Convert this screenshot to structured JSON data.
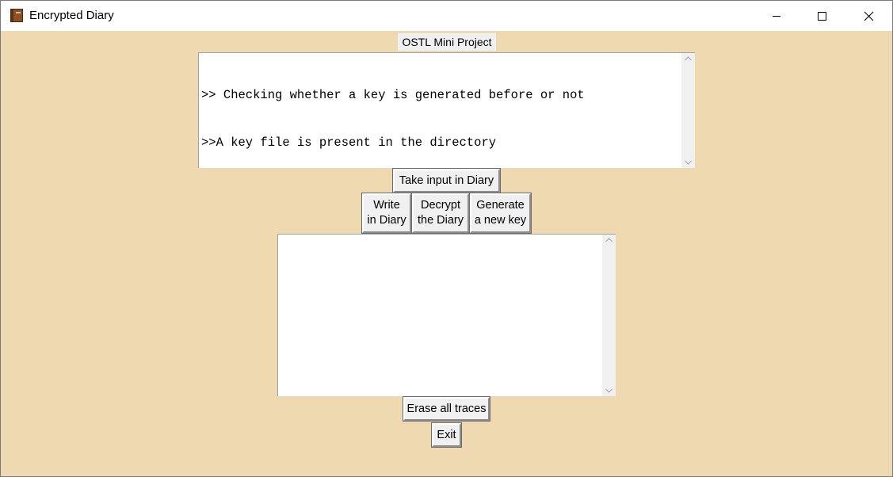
{
  "window": {
    "title": "Encrypted Diary",
    "icon": "diary-book-icon",
    "controls": [
      "minimize-icon",
      "maximize-icon",
      "close-icon"
    ]
  },
  "header": {
    "label": "OSTL Mini Project"
  },
  "log": {
    "lines": [
      ">> Checking whether a key is generated before or not",
      ">>A key file is present in the directory"
    ]
  },
  "buttons": {
    "take_input": "Take input in Diary",
    "write": [
      "Write",
      "in Diary"
    ],
    "decrypt": [
      "Decrypt",
      "the Diary"
    ],
    "generate": [
      "Generate",
      "a new key"
    ],
    "erase": "Erase all traces",
    "exit": "Exit"
  },
  "input": {
    "value": ""
  },
  "colors": {
    "background": "#eed9b0",
    "titlebar": "#ffffff",
    "button_face": "#f0f0f0"
  }
}
